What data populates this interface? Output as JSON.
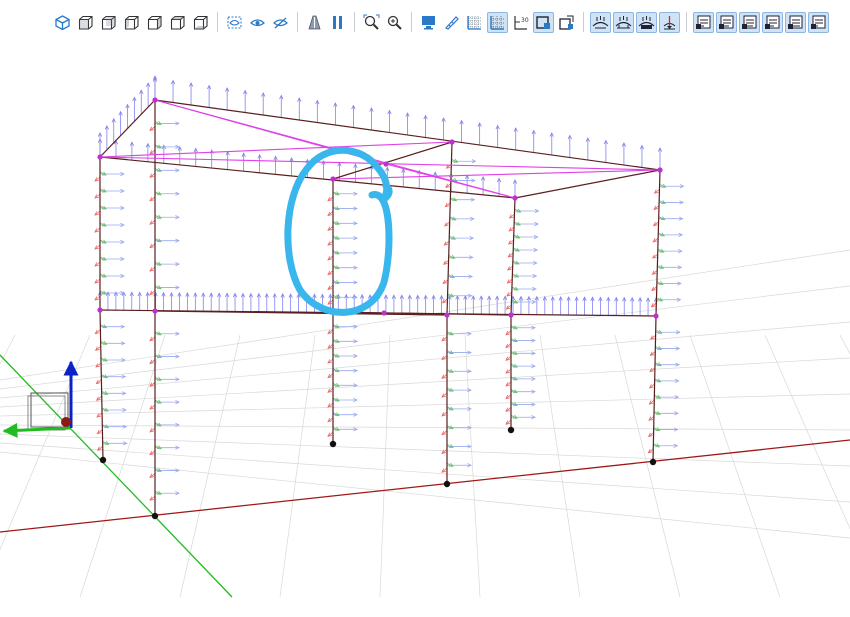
{
  "colors": {
    "toolbar_icon": "#2a78c8",
    "toolbar_active_bg": "#cfe3f7",
    "highlight": "#f4ff00",
    "frame_member": "#5a1f1f",
    "roof_bracing": "#e040e8",
    "node": "#c030d0",
    "support": "#111111",
    "load_vertical": "#8080ee",
    "load_horizontal": "#9aa8f0",
    "load_red": "#ee6666",
    "load_green": "#66c066",
    "grid": "#d8d8d8",
    "axis_x": "#a01818",
    "axis_y": "#22bb22",
    "axis_z": "#0a22c8",
    "annotation_circle": "#39b7ec"
  },
  "toolbar": {
    "groups": [
      {
        "name": "views",
        "buttons": [
          {
            "icon": "isometric-view-icon",
            "active": false
          },
          {
            "icon": "front-view-icon",
            "active": false
          },
          {
            "icon": "back-view-icon",
            "active": false
          },
          {
            "icon": "left-view-icon",
            "active": false
          },
          {
            "icon": "right-view-icon",
            "active": false
          },
          {
            "icon": "top-view-icon",
            "active": false
          },
          {
            "icon": "bottom-view-icon",
            "active": false
          }
        ]
      },
      {
        "name": "visibility",
        "buttons": [
          {
            "icon": "show-selection-icon",
            "active": false
          },
          {
            "icon": "eye-icon",
            "active": false
          },
          {
            "icon": "hide-icon",
            "active": false
          }
        ]
      },
      {
        "name": "perspective",
        "buttons": [
          {
            "icon": "perspective-icon",
            "active": false
          },
          {
            "icon": "parallel-icon",
            "active": false
          }
        ]
      },
      {
        "name": "zoom",
        "buttons": [
          {
            "icon": "zoom-extents-icon",
            "active": false
          },
          {
            "icon": "zoom-window-icon",
            "active": false
          }
        ]
      },
      {
        "name": "display",
        "buttons": [
          {
            "icon": "render-view-icon",
            "active": false
          },
          {
            "icon": "measure-icon",
            "active": false
          },
          {
            "icon": "grid-icon",
            "active": false
          },
          {
            "icon": "snap-grid-icon",
            "active": true
          },
          {
            "icon": "angle-icon",
            "active": false
          },
          {
            "icon": "section-box-icon",
            "active": true
          },
          {
            "icon": "section-cut-icon",
            "active": false
          }
        ]
      },
      {
        "name": "loads",
        "buttons": [
          {
            "icon": "nodal-loads-icon",
            "active": true
          },
          {
            "icon": "member-loads-icon",
            "active": true
          },
          {
            "icon": "area-loads-icon",
            "active": true
          },
          {
            "icon": "support-reactions-icon",
            "active": true,
            "highlighted": true
          }
        ]
      },
      {
        "name": "labels",
        "buttons": [
          {
            "icon": "node-labels-icon",
            "active": true
          },
          {
            "icon": "member-labels-icon",
            "active": true
          },
          {
            "icon": "plate-labels-icon",
            "active": true
          },
          {
            "icon": "section-labels-icon",
            "active": true
          },
          {
            "icon": "material-labels-icon",
            "active": true
          },
          {
            "icon": "load-labels-icon",
            "active": true
          }
        ]
      }
    ]
  }
}
